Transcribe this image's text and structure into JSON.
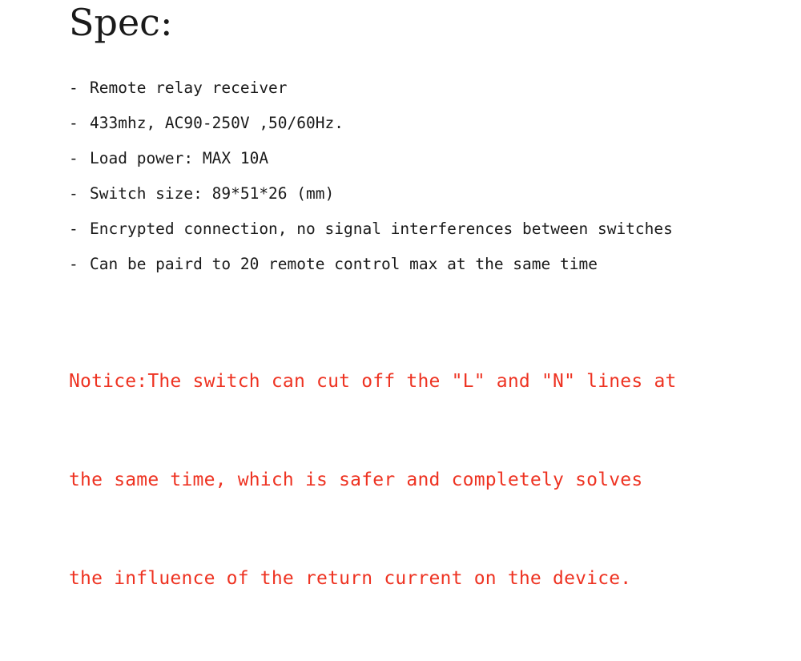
{
  "document": {
    "title": "Spec:",
    "spec_items": [
      {
        "bullet": "-",
        "text": "Remote relay receiver"
      },
      {
        "bullet": "-",
        "text": "433mhz, AC90-250V ,50/60Hz."
      },
      {
        "bullet": "-",
        "text": "Load power: MAX 10A"
      },
      {
        "bullet": "-",
        "text": "Switch size: 89*51*26 (mm)"
      },
      {
        "bullet": "-",
        "text": "Encrypted connection, no signal interferences between switches"
      },
      {
        "bullet": "-",
        "text": "Can be paird to 20 remote control max at the same time"
      }
    ],
    "notice": {
      "lines": [
        "Notice:The switch can cut off the \"L\" and \"N\" lines at",
        "the same time, which is safer and completely solves",
        "the influence of the return current on the device."
      ],
      "color": "#ee3322"
    },
    "text_color": "#1a1a1a",
    "background_color": "#ffffff"
  }
}
